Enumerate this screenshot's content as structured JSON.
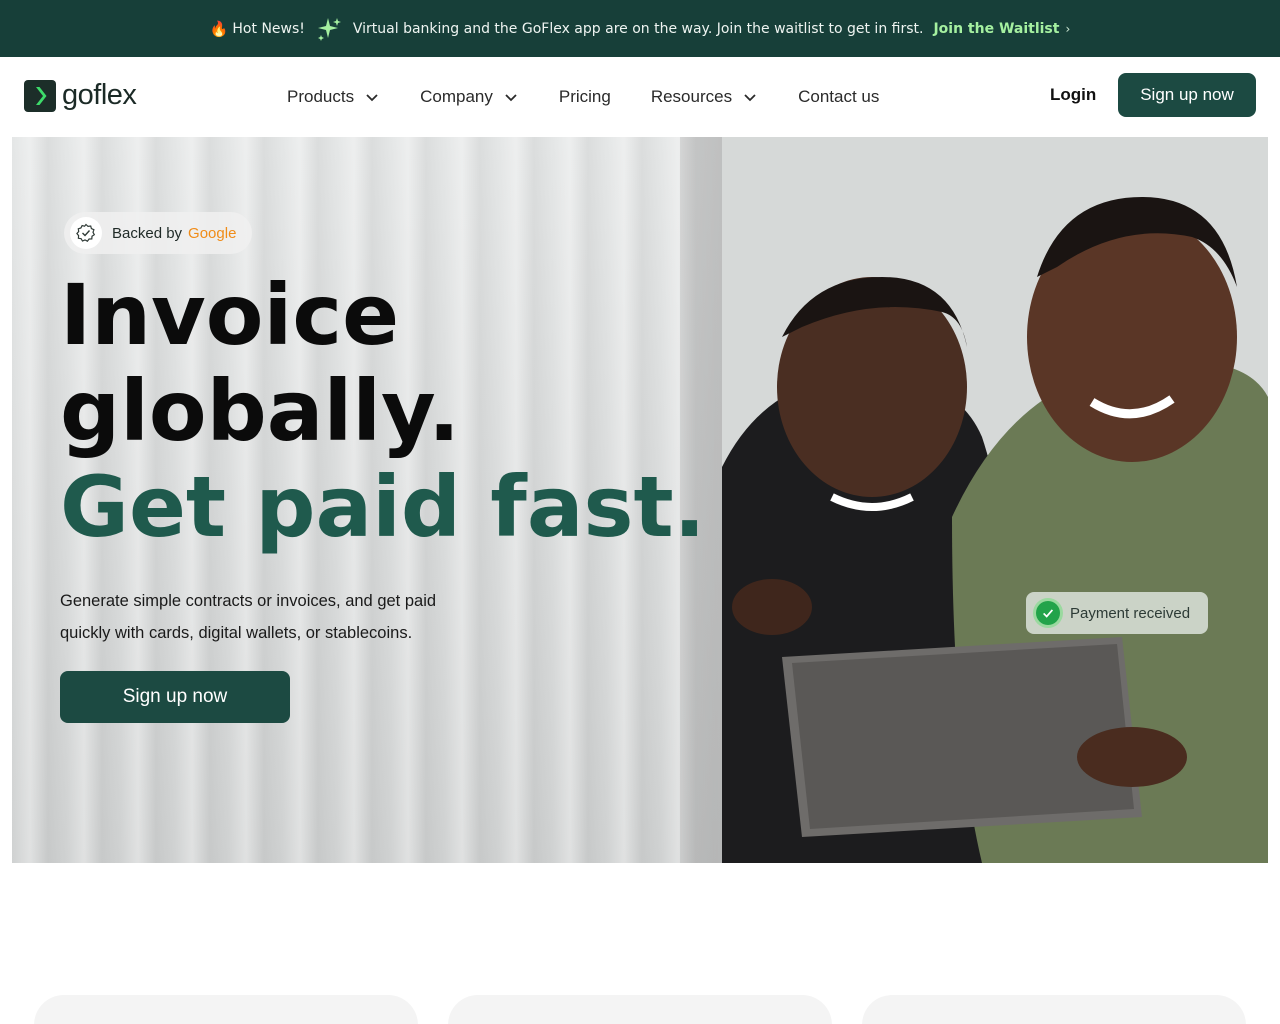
{
  "announcement": {
    "fire_icon": "fire-icon",
    "hot_label": "Hot News!",
    "sparkle_icon": "sparkle-icon",
    "message": "Virtual banking and the GoFlex app are on the way. Join the waitlist to get in first.",
    "cta_label": "Join the Waitlist",
    "cta_icon": "chevron-right-icon",
    "background": "#173f39",
    "cta_color": "#a5f0a0"
  },
  "header": {
    "logo_text": "goflex",
    "nav": [
      {
        "label": "Products",
        "dropdown": true
      },
      {
        "label": "Company",
        "dropdown": true
      },
      {
        "label": "Pricing",
        "dropdown": false
      },
      {
        "label": "Resources",
        "dropdown": true
      },
      {
        "label": "Contact us",
        "dropdown": false
      }
    ],
    "login_label": "Login",
    "signup_label": "Sign up now",
    "brand_color": "#1c4a42"
  },
  "hero": {
    "badge_prefix": "Backed by",
    "badge_brand": "Google",
    "headline_line1": "Invoice",
    "headline_line2": "globally.",
    "headline_line3": "Get paid fast.",
    "subtext_line1": "Generate simple contracts or invoices, and get paid",
    "subtext_line2": "quickly with cards, digital wallets, or stablecoins.",
    "cta_label": "Sign up now",
    "toast_label": "Payment received",
    "accent_color": "#1f5a4d"
  }
}
